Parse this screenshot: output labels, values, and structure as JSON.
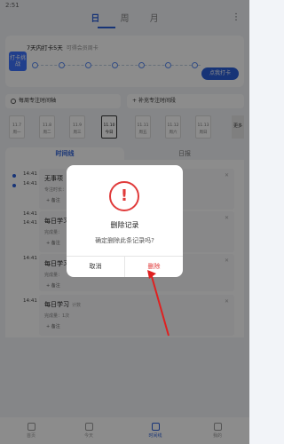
{
  "status_bar": {
    "time": "2:51"
  },
  "top_tabs": [
    "日",
    "周",
    "月"
  ],
  "more_icon": "more-vertical-icon",
  "checkin": {
    "badge": "打卡挑战",
    "title": "7天内打卡5天",
    "subtitle": "可得会员周卡",
    "button": "点我打卡"
  },
  "actions": {
    "left": "每周专注时间轴",
    "right": "补充专注时间段"
  },
  "days": [
    {
      "date": "11.7",
      "weekday": "周一"
    },
    {
      "date": "11.8",
      "weekday": "周二"
    },
    {
      "date": "11.9",
      "weekday": "周三"
    },
    {
      "date": "11.10",
      "weekday": "今日"
    },
    {
      "date": "11.11",
      "weekday": "周五"
    },
    {
      "date": "11.12",
      "weekday": "周六"
    },
    {
      "date": "11.13",
      "weekday": "周日"
    }
  ],
  "more_days": "更多",
  "segments": {
    "timeline": "时间线",
    "daily": "日报"
  },
  "timeline": [
    {
      "time1": "14:41",
      "time2": "14:41",
      "title": "无事项",
      "sub": "专注时长：",
      "note": "+ 备注"
    },
    {
      "time1": "14:41",
      "time2": "14:41",
      "title": "每日学习",
      "sub": "完成量：",
      "note": "+ 备注"
    },
    {
      "time1": "14:41",
      "time2": "",
      "title": "每日学习",
      "sub": "完成量：",
      "note": "+ 备注"
    },
    {
      "time1": "14:41",
      "time2": "",
      "title": "每日学习",
      "tag": "计数",
      "sub": "完成量：1次",
      "note": "+ 备注"
    }
  ],
  "nav": [
    "首页",
    "今天",
    "时间线",
    "我的"
  ],
  "dialog": {
    "title": "删除记录",
    "message": "确定删除此条记录吗?",
    "cancel": "取消",
    "confirm": "删除"
  },
  "colors": {
    "accent": "#2b5fd9",
    "danger": "#e03b3b"
  }
}
